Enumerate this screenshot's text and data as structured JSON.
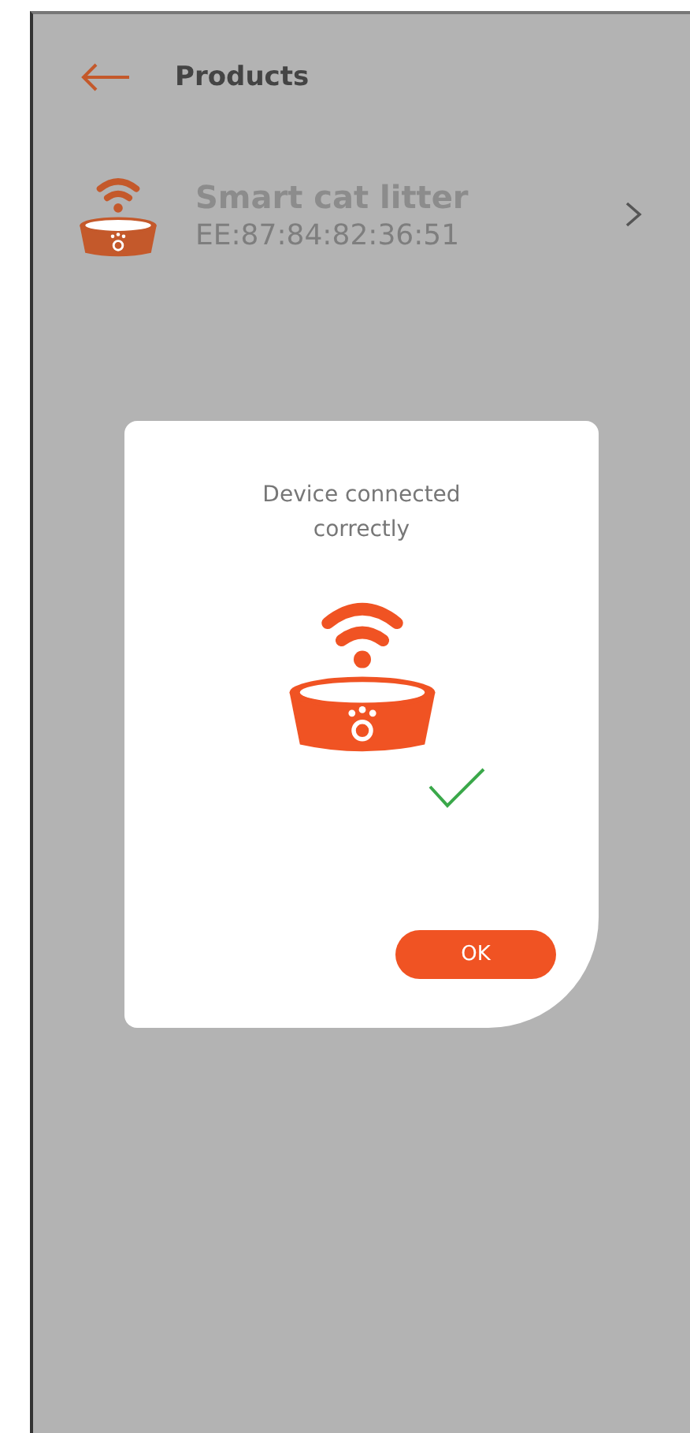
{
  "header": {
    "title": "Products"
  },
  "products": [
    {
      "name": "Smart cat litter",
      "address": "EE:87:84:82:36:51"
    }
  ],
  "dialog": {
    "message": "Device connected correctly",
    "connected": true,
    "button": "OK"
  }
}
